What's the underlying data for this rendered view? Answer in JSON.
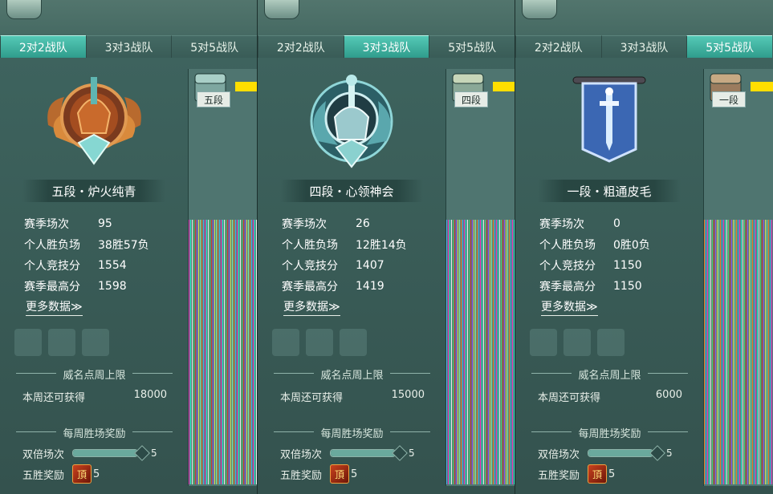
{
  "tabs": [
    "2对2战队",
    "3对3战队",
    "5对5战队"
  ],
  "labels": {
    "season_matches": "赛季场次",
    "record": "个人胜负场",
    "score": "个人竞技分",
    "max_score": "赛季最高分",
    "more": "更多数据≫",
    "weekly_limit_title": "威名点周上限",
    "weekly_remaining": "本周还可获得",
    "weekly_win_title": "每周胜场奖励",
    "double_matches": "双倍场次",
    "five_win_reward": "五胜奖励",
    "reward_glyph": "頂"
  },
  "panels": [
    {
      "active_tab": 0,
      "rank_name": "五段・炉火纯青",
      "chest_label": "五段",
      "season_matches": "95",
      "record": "38胜57负",
      "score": "1554",
      "max_score": "1598",
      "weekly_remaining": "18000",
      "double_matches_value": "5",
      "double_progress": 1,
      "five_win_count": "5",
      "emblem": "bronze-winged-emblem-icon"
    },
    {
      "active_tab": 1,
      "rank_name": "四段・心领神会",
      "chest_label": "四段",
      "season_matches": "26",
      "record": "12胜14负",
      "score": "1407",
      "max_score": "1419",
      "weekly_remaining": "15000",
      "double_matches_value": "5",
      "double_progress": 1,
      "five_win_count": "5",
      "emblem": "silver-dragon-emblem-icon"
    },
    {
      "active_tab": 2,
      "rank_name": "一段・粗通皮毛",
      "chest_label": "一段",
      "season_matches": "0",
      "record": "0胜0负",
      "score": "1150",
      "max_score": "1150",
      "weekly_remaining": "6000",
      "double_matches_value": "5",
      "double_progress": 1,
      "five_win_count": "5",
      "emblem": "blue-sword-banner-icon"
    }
  ],
  "colors": {
    "tab_active": "#3fb3a2",
    "panel_bg": "#3f6560",
    "progress_yellow": "#ffde00"
  }
}
